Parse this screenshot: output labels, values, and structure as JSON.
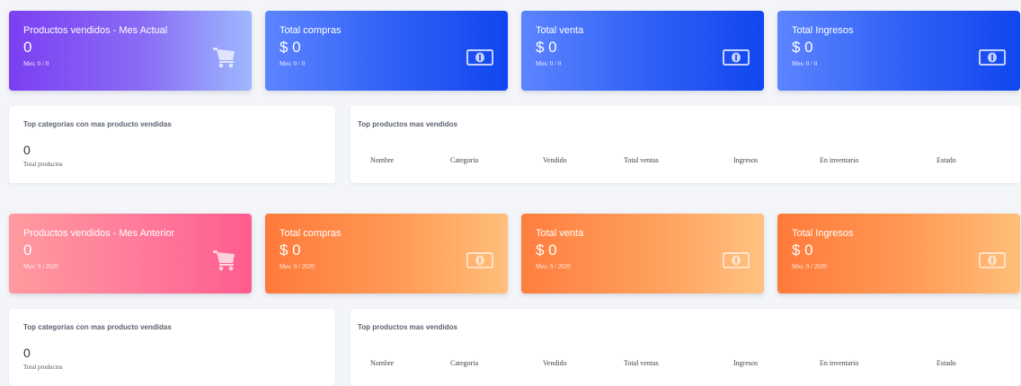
{
  "current": {
    "products_card": {
      "title": "Productos vendidos - Mes Actual",
      "value": "0",
      "sub": "Mes: 0 / 0",
      "icon": "shopping-cart-icon"
    },
    "purchases_card": {
      "title": "Total compras",
      "value": "$ 0",
      "sub": "Mes: 0 / 0",
      "icon": "money-bill-icon"
    },
    "sales_card": {
      "title": "Total venta",
      "value": "$ 0",
      "sub": "Mes: 0 / 0",
      "icon": "money-bill-icon"
    },
    "income_card": {
      "title": "Total Ingresos",
      "value": "$ 0",
      "sub": "Mes: 0 / 0",
      "icon": "money-bill-icon"
    },
    "top_categories": {
      "title": "Top categorias con mas producto vendidas",
      "value": "0",
      "label": "Total productos"
    },
    "top_products": {
      "title": "Top productos mas vendidos"
    }
  },
  "previous": {
    "products_card": {
      "title": "Productos vendidos - Mes Anterior",
      "value": "0",
      "sub": "Mes: 9 / 2020",
      "icon": "shopping-cart-icon"
    },
    "purchases_card": {
      "title": "Total compras",
      "value": "$ 0",
      "sub": "Mes: 9 / 2020",
      "icon": "money-bill-icon"
    },
    "sales_card": {
      "title": "Total venta",
      "value": "$ 0",
      "sub": "Mes: 9 / 2020",
      "icon": "money-bill-icon"
    },
    "income_card": {
      "title": "Total Ingresos",
      "value": "$ 0",
      "sub": "Mes: 9 / 2020",
      "icon": "money-bill-icon"
    },
    "top_categories": {
      "title": "Top categorias con mas producto vendidas",
      "value": "0",
      "label": "Total productos"
    },
    "top_products": {
      "title": "Top productos mas vendidos"
    }
  },
  "table_headers": [
    "Nombre",
    "Categoria",
    "Vendido",
    "Total ventas",
    "Ingresos",
    "En inventario",
    "Estado"
  ],
  "colors": {
    "purple": "#7b3ff2",
    "blue": "#2d5ff5",
    "pink": "#ff6f94",
    "orange": "#ff8a45",
    "background": "#f3f5f9"
  }
}
